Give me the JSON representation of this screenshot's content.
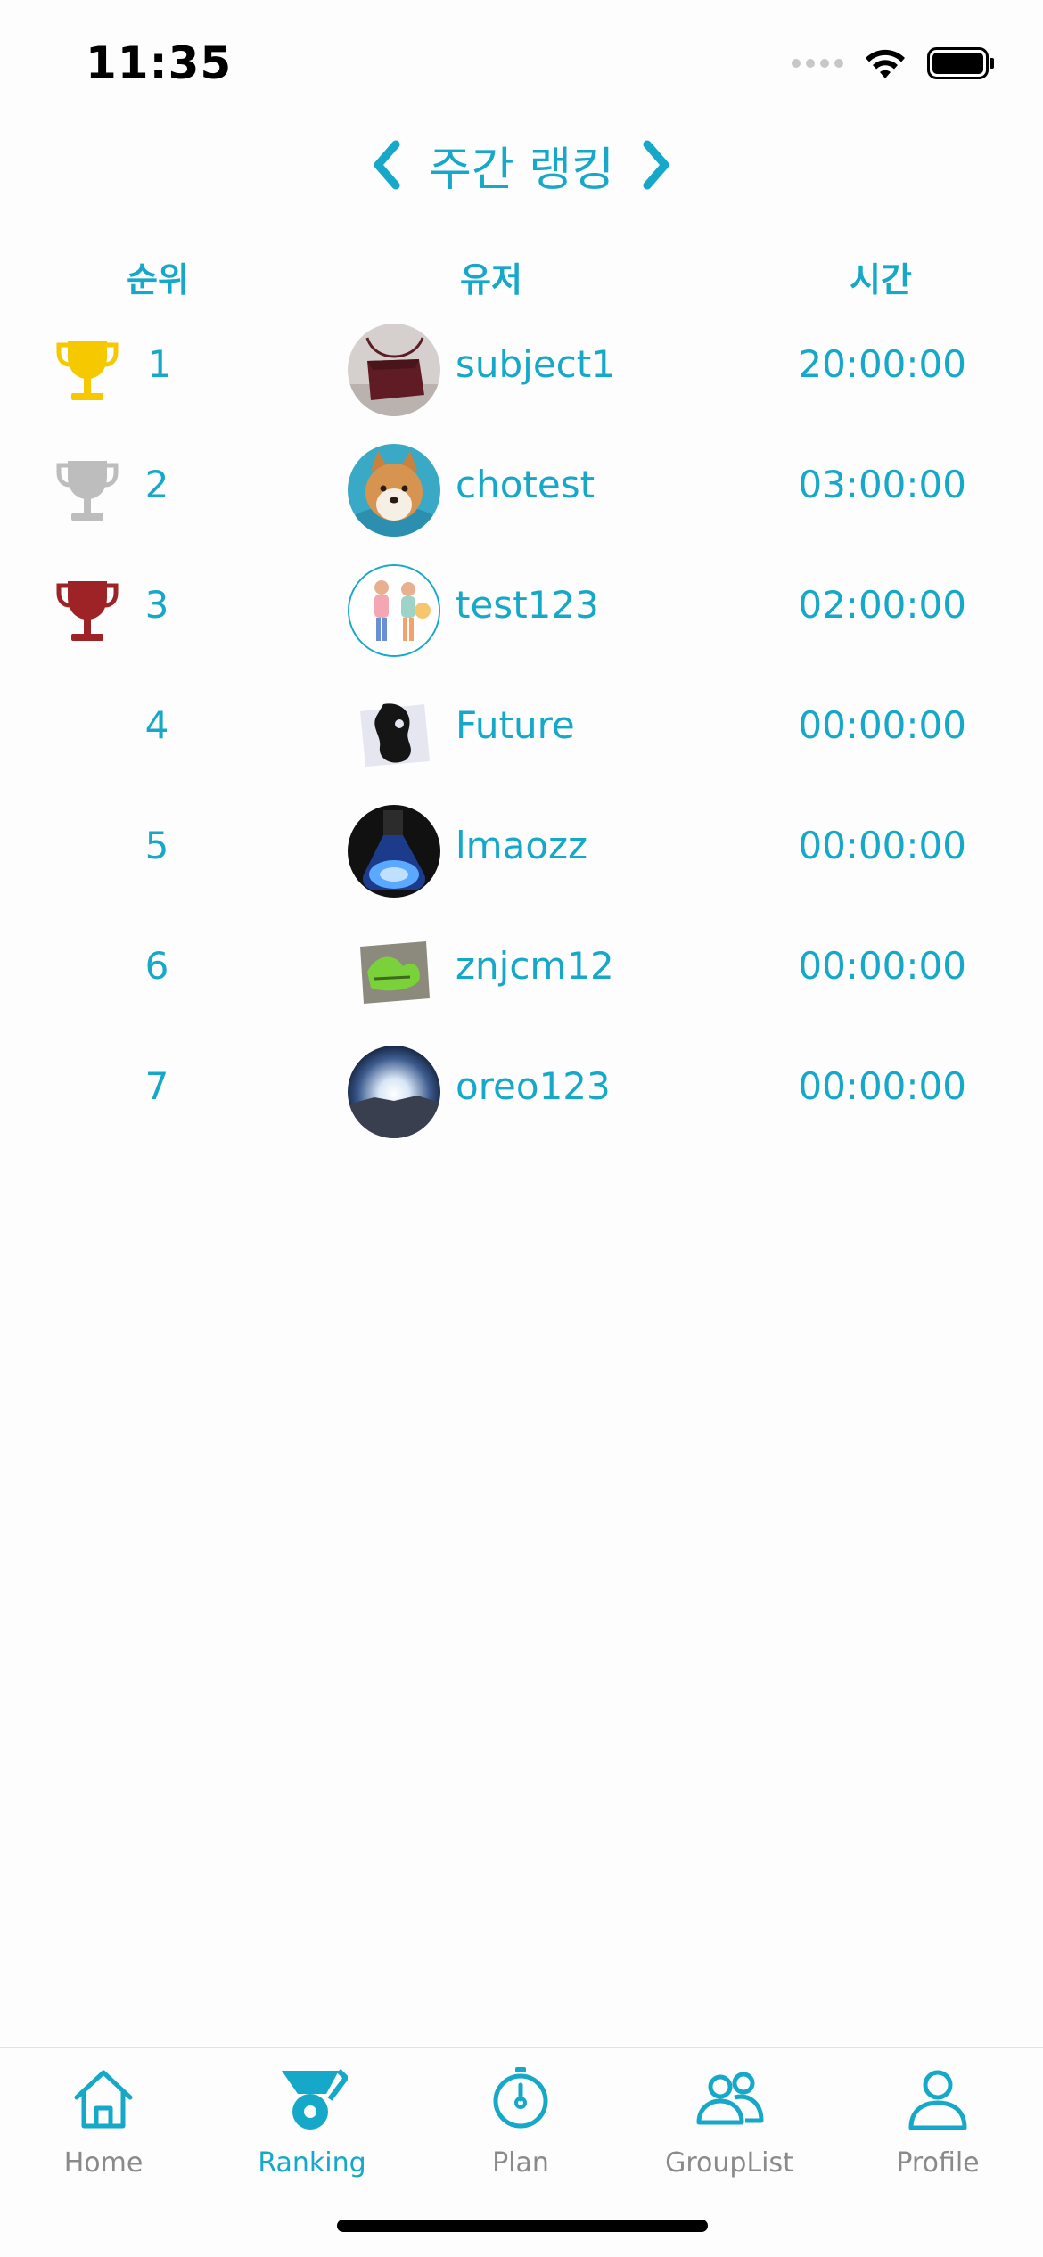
{
  "status_bar": {
    "time": "11:35"
  },
  "header": {
    "title": "주간 랭킹",
    "prev_icon": "chevron-left-icon",
    "next_icon": "chevron-right-icon"
  },
  "columns": {
    "rank": "순위",
    "user": "유저",
    "time": "시간"
  },
  "rows": [
    {
      "rank": "1",
      "username": "subject1",
      "time": "20:00:00",
      "trophy": "gold"
    },
    {
      "rank": "2",
      "username": "chotest",
      "time": "03:00:00",
      "trophy": "silver"
    },
    {
      "rank": "3",
      "username": "test123",
      "time": "02:00:00",
      "trophy": "bronze"
    },
    {
      "rank": "4",
      "username": "Future",
      "time": "00:00:00",
      "trophy": ""
    },
    {
      "rank": "5",
      "username": "lmaozz",
      "time": "00:00:00",
      "trophy": ""
    },
    {
      "rank": "6",
      "username": "znjcm12",
      "time": "00:00:00",
      "trophy": ""
    },
    {
      "rank": "7",
      "username": "oreo123",
      "time": "00:00:00",
      "trophy": ""
    }
  ],
  "tabs": [
    {
      "label": "Home",
      "icon": "home-icon",
      "active": false
    },
    {
      "label": "Ranking",
      "icon": "ranking-medal-icon",
      "active": true
    },
    {
      "label": "Plan",
      "icon": "timer-icon",
      "active": false
    },
    {
      "label": "GroupList",
      "icon": "group-icon",
      "active": false
    },
    {
      "label": "Profile",
      "icon": "person-icon",
      "active": false
    }
  ],
  "colors": {
    "accent": "#16a8c9",
    "gold": "#f5c800",
    "silver": "#bdbdbd",
    "bronze": "#9e2326",
    "inactive": "#8a8a8a"
  }
}
